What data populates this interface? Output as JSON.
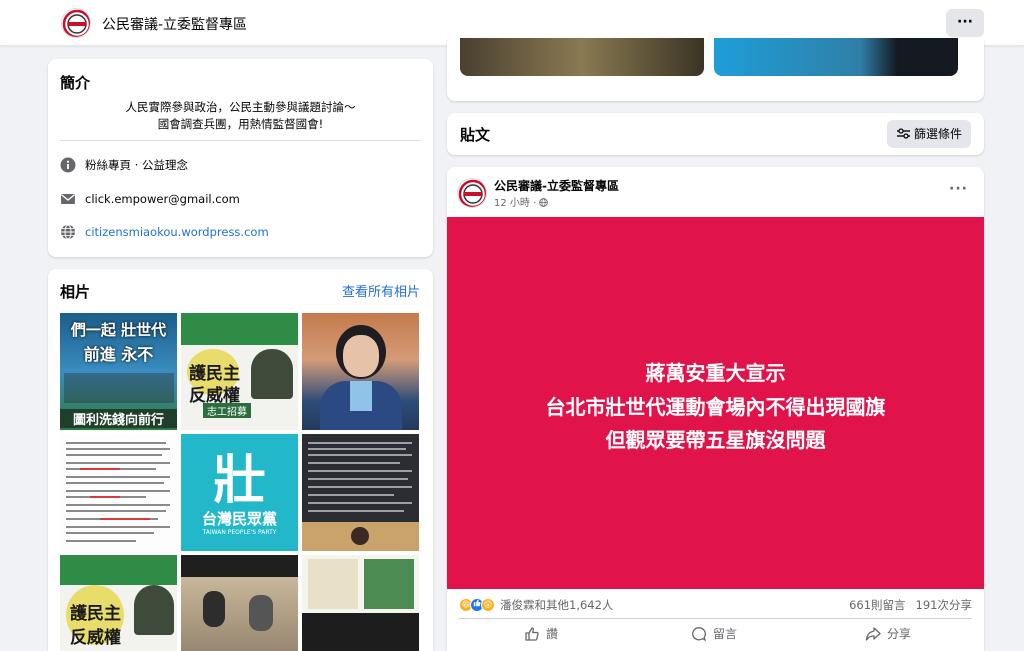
{
  "topbar": {
    "page_name": "公民審議-立委監督專區",
    "more_label": "···"
  },
  "intro": {
    "title": "簡介",
    "bio_line1": "人民實際參與政治，公民主動參與議題討論～",
    "bio_line2": "國會調查兵團，用熱情監督國會!",
    "category": "粉絲專頁 · 公益理念",
    "email": "click.empower@gmail.com",
    "website": "citizensmiaokou.wordpress.com"
  },
  "photos": {
    "title": "相片",
    "see_all": "查看所有相片",
    "tiles": [
      {
        "caption_top": "們一起 壯世代",
        "caption_mid": "前進 永不",
        "caption_bottom": "圖利洗錢向前行"
      },
      {
        "caption_top": "護民主",
        "caption_mid": "反威權",
        "caption_bottom": "志工招募"
      },
      {
        "caption_top": ""
      },
      {
        "caption_top": ""
      },
      {
        "caption_top": "壯",
        "caption_mid": "台灣民眾黨",
        "caption_bottom": "TAIWAN PEOPLE'S PARTY"
      },
      {
        "caption_top": ""
      },
      {
        "caption_top": "護民主",
        "caption_mid": "反威權"
      },
      {
        "caption_top": ""
      },
      {
        "caption_top": ""
      }
    ]
  },
  "posts_header": {
    "title": "貼文",
    "filter_label": "篩選條件"
  },
  "post": {
    "author": "公民審議-立委監督專區",
    "time": "12 小時 · ",
    "banner_line1": "蔣萬安重大宣示",
    "banner_line2": "台北市壯世代運動會場內不得出現國旗",
    "banner_line3": "但觀眾要帶五星旗沒問題",
    "reaction_names": "潘俊霖和其他1,642人",
    "comments": "661則留言",
    "shares": "191次分享",
    "like_label": "讚",
    "comment_label": "留言",
    "share_label": "分享"
  },
  "colors": {
    "accent": "#216fdb",
    "banner": "#e0144b",
    "background": "#f0f2f5"
  }
}
